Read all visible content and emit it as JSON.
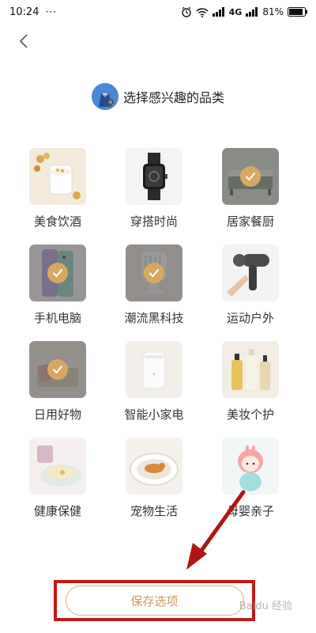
{
  "status_bar": {
    "time": "10:24",
    "dots": "···",
    "network": "4G",
    "battery": "81%"
  },
  "header": {
    "title": "选择感兴趣的品类"
  },
  "categories": [
    {
      "label": "美食饮酒",
      "selected": false,
      "icon": "food-drink-image"
    },
    {
      "label": "穿搭时尚",
      "selected": false,
      "icon": "watch-image"
    },
    {
      "label": "居家餐厨",
      "selected": true,
      "icon": "home-bed-image"
    },
    {
      "label": "手机电脑",
      "selected": true,
      "icon": "phone-image"
    },
    {
      "label": "潮流黑科技",
      "selected": true,
      "icon": "fan-image"
    },
    {
      "label": "运动户外",
      "selected": false,
      "icon": "massage-gun-image"
    },
    {
      "label": "日用好物",
      "selected": true,
      "icon": "tissue-box-image"
    },
    {
      "label": "智能小家电",
      "selected": false,
      "icon": "humidifier-image"
    },
    {
      "label": "美妆个护",
      "selected": false,
      "icon": "bottles-image"
    },
    {
      "label": "健康保健",
      "selected": false,
      "icon": "bowl-image"
    },
    {
      "label": "宠物生活",
      "selected": false,
      "icon": "pet-bed-image"
    },
    {
      "label": "母婴亲子",
      "selected": false,
      "icon": "bunny-toy-image"
    }
  ],
  "save_button": {
    "label": "保存选项"
  },
  "watermark": "Baidu 经验"
}
